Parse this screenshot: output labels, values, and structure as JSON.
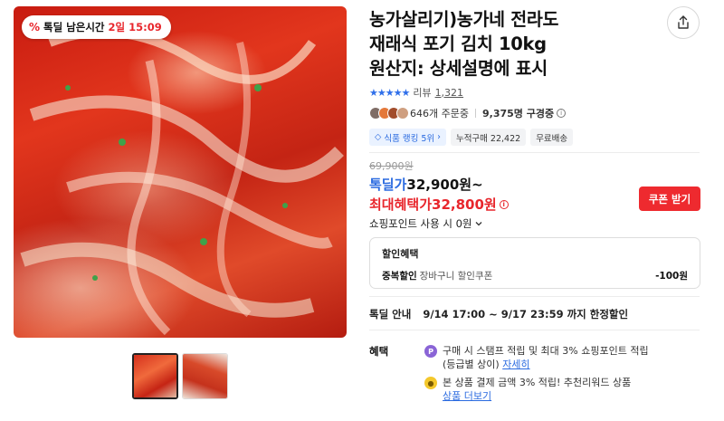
{
  "gallery": {
    "deal_badge": {
      "label": "톡딜 남은시간",
      "time": "2일 15:09"
    },
    "thumbnails": 2,
    "active_thumbnail": 1
  },
  "product": {
    "title_lines": [
      "농가살리기)농가네 전라도",
      "재래식 포기 김치 10kg",
      "원산지: 상세설명에 표시"
    ],
    "rating": 4.5,
    "review_label": "리뷰",
    "review_count": "1,321",
    "ordering": "646개 주문중",
    "subscribers": "9,375명 구경중",
    "badges": [
      "식품 랭킹 5위",
      "누적구매 22,422",
      "무료배송"
    ]
  },
  "price": {
    "original": "69,900원",
    "deal_label": "톡딜가",
    "deal_price": "32,900원~",
    "max_label": "최대혜택가",
    "max_price": "32,800원",
    "coupon_button": "쿠폰 받기",
    "points_label": "쇼핑포인트 사용 시 0원"
  },
  "discount_box": {
    "title": "할인혜택",
    "line_label": "중복할인",
    "line_desc": "장바구니 할인쿠폰",
    "line_amount": "-100원"
  },
  "deal_info": {
    "label": "톡딜 안내",
    "value": "9/14 17:00 ~ 9/17 23:59 까지 한정할인"
  },
  "benefits": {
    "label": "혜택",
    "items": [
      {
        "icon": "point-coin-icon",
        "text1": "구매 시 스탬프 적립 및 최대 3% 쇼핑포인트 적립",
        "text2": "(등급별 상이)",
        "link": "자세히"
      },
      {
        "icon": "coupon-coin-icon",
        "text1": "본 상품 결제 금액 3% 적립! 추천리워드 상품",
        "link": "상품 더보기"
      }
    ]
  },
  "colors": {
    "accent_blue": "#2b6be0",
    "accent_red": "#e8262c",
    "coupon_red": "#ee2a2f"
  }
}
